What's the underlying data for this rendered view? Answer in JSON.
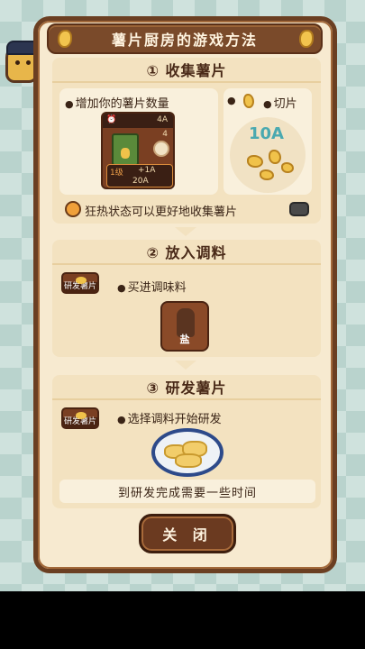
{
  "title": "薯片厨房的游戏方法",
  "section1": {
    "title": "① 收集薯片",
    "bullet_left": "增加你的薯片数量",
    "bullet_right": "切片",
    "card": {
      "top_right": "4A",
      "mid_right": "4",
      "level": "1级",
      "gain": "+1A",
      "cost": "20A"
    },
    "amount": "10A",
    "fever_text": "狂热状态可以更好地收集薯片"
  },
  "section2": {
    "title": "② 放入调料",
    "button_label": "研发薯片",
    "bullet": "买进调味料",
    "salt_label": "盐"
  },
  "section3": {
    "title": "③ 研发薯片",
    "button_label": "研发薯片",
    "bullet": "选择调料开始研发",
    "footer_note": "到研发完成需要一些时间"
  },
  "close_label": "关 闭"
}
